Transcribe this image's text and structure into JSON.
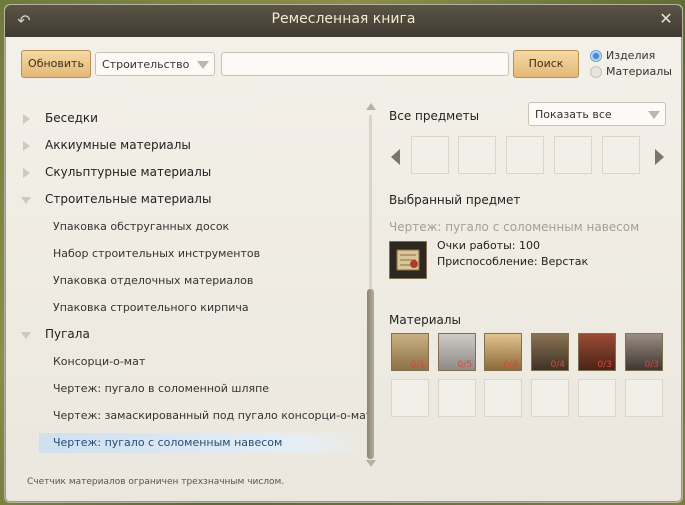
{
  "window": {
    "title": "Ремесленная книга"
  },
  "toolbar": {
    "refresh_label": "Обновить",
    "category_value": "Строительство",
    "search_value": "",
    "search_label": "Поиск"
  },
  "radio": {
    "items_label": "Изделия",
    "materials_label": "Материалы"
  },
  "tree": {
    "cat1": "Беседки",
    "cat2": "Аккиумные материалы",
    "cat3": "Скульптурные материалы",
    "cat4": "Строительные материалы",
    "cat4_items": [
      "Упаковка обструганных досок",
      "Набор строительных инструментов",
      "Упаковка отделочных материалов",
      "Упаковка строительного кирпича"
    ],
    "cat5": "Пугала",
    "cat5_items": [
      "Консорци-о-мат",
      "Чертеж: пугало в соломенной шляпе",
      "Чертеж: замаскированный под пугало консорци-о-мат",
      "Чертеж: пугало с соломенным навесом"
    ]
  },
  "right": {
    "all_items_label": "Все предметы",
    "show_all_value": "Показать все",
    "selected_label": "Выбранный предмет",
    "item_name": "Чертеж: пугало с соломенным навесом",
    "work_points": "Очки работы: 100",
    "tool": "Приспособление: Верстак",
    "materials_label": "Материалы",
    "materials_counts": [
      "0/1",
      "0/5",
      "0/4",
      "0/4",
      "0/3",
      "0/3"
    ]
  },
  "footer": {
    "text": "Счетчик материалов ограничен трехзначным числом."
  }
}
